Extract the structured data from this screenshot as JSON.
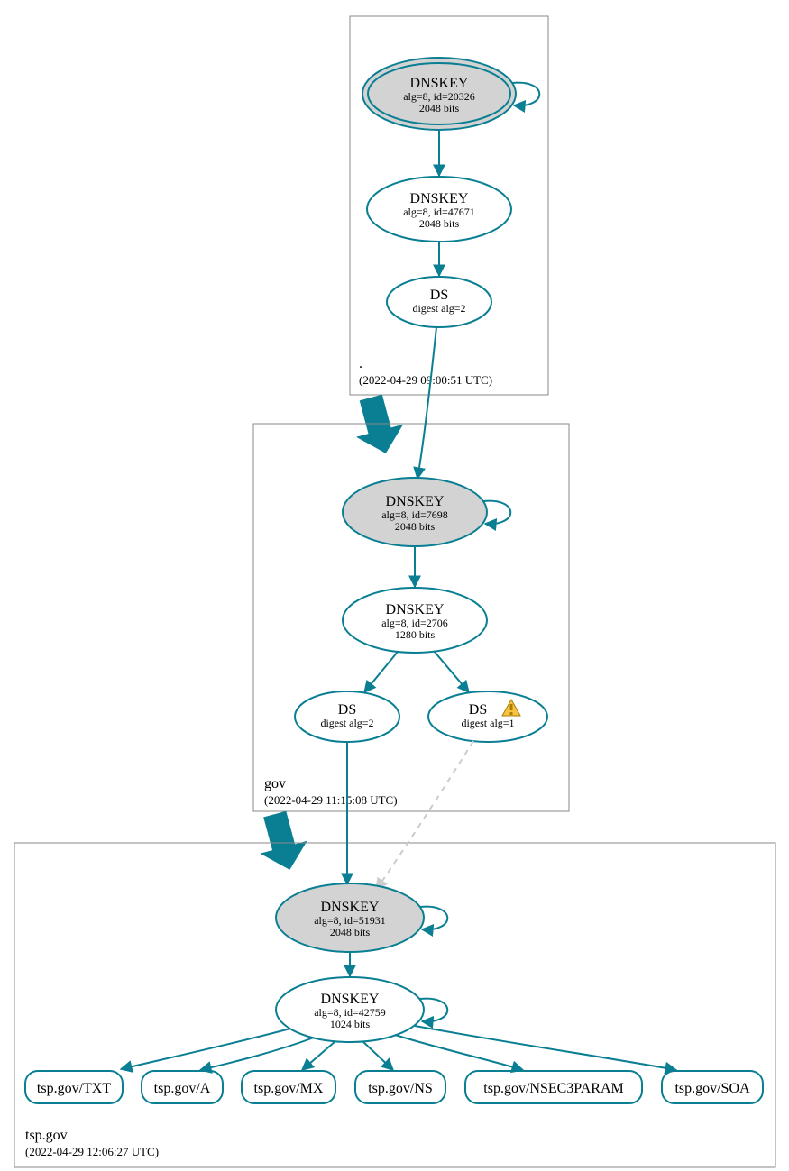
{
  "zones": {
    "root": {
      "label_dot": ".",
      "timestamp": "(2022-04-29 09:00:51 UTC)"
    },
    "gov": {
      "label": "gov",
      "timestamp": "(2022-04-29 11:15:08 UTC)"
    },
    "tsp": {
      "label": "tsp.gov",
      "timestamp": "(2022-04-29 12:06:27 UTC)"
    }
  },
  "nodes": {
    "root_ksk": {
      "title": "DNSKEY",
      "sub1": "alg=8, id=20326",
      "sub2": "2048 bits"
    },
    "root_zsk": {
      "title": "DNSKEY",
      "sub1": "alg=8, id=47671",
      "sub2": "2048 bits"
    },
    "root_ds": {
      "title": "DS",
      "sub1": "digest alg=2"
    },
    "gov_ksk": {
      "title": "DNSKEY",
      "sub1": "alg=8, id=7698",
      "sub2": "2048 bits"
    },
    "gov_zsk": {
      "title": "DNSKEY",
      "sub1": "alg=8, id=2706",
      "sub2": "1280 bits"
    },
    "gov_ds2": {
      "title": "DS",
      "sub1": "digest alg=2"
    },
    "gov_ds1": {
      "title": "DS",
      "sub1": "digest alg=1"
    },
    "tsp_ksk": {
      "title": "DNSKEY",
      "sub1": "alg=8, id=51931",
      "sub2": "2048 bits"
    },
    "tsp_zsk": {
      "title": "DNSKEY",
      "sub1": "alg=8, id=42759",
      "sub2": "1024 bits"
    }
  },
  "rrsets": {
    "txt": "tsp.gov/TXT",
    "a": "tsp.gov/A",
    "mx": "tsp.gov/MX",
    "ns": "tsp.gov/NS",
    "nsec3param": "tsp.gov/NSEC3PARAM",
    "soa": "tsp.gov/SOA"
  },
  "icons": {
    "warning": "warning-icon"
  }
}
